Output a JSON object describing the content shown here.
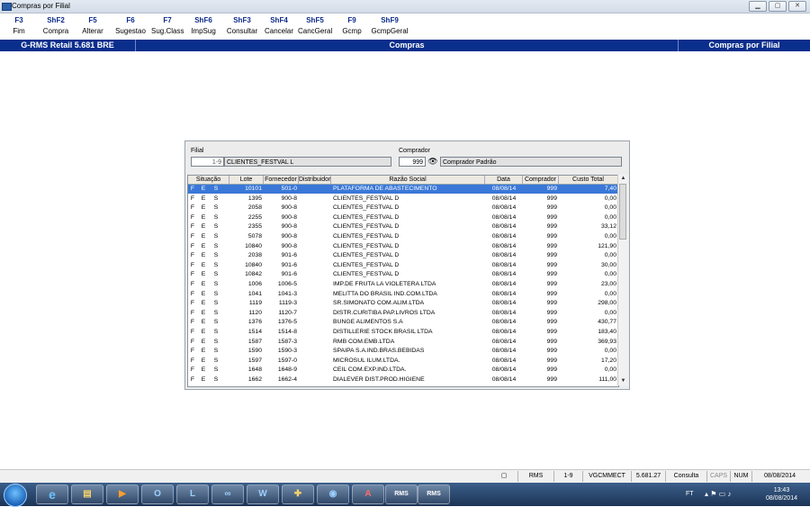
{
  "window": {
    "title": "Compras por Filial"
  },
  "fkeys": [
    {
      "key": "F3",
      "label": "Fim"
    },
    {
      "key": "ShF2",
      "label": "Compra"
    },
    {
      "key": "F5",
      "label": "Alterar"
    },
    {
      "key": "F6",
      "label": "Sugestao"
    },
    {
      "key": "F7",
      "label": "Sug.Class"
    },
    {
      "key": "ShF6",
      "label": "ImpSug"
    },
    {
      "key": "ShF3",
      "label": "Consultar"
    },
    {
      "key": "ShF4",
      "label": "Cancelar"
    },
    {
      "key": "ShF5",
      "label": "CancGeral"
    },
    {
      "key": "F9",
      "label": "Gcmp"
    },
    {
      "key": "ShF9",
      "label": "GcmpGeral"
    }
  ],
  "header": {
    "app": "G-RMS Retail 5.681 BRE",
    "module": "Compras",
    "screen": "Compras por Filial"
  },
  "filter": {
    "filial_label": "Filial",
    "filial_code": "1-9",
    "filial_name": "CLIENTES_FESTVAL L",
    "comprador_label": "Comprador",
    "comprador_code": "999",
    "comprador_name": "Comprador Padrão"
  },
  "grid": {
    "columns": [
      "Situação",
      "Lote",
      "Fornecedor",
      "Distribuidor",
      "Razão Social",
      "Data",
      "Comprador",
      "Custo Total"
    ],
    "rows": [
      {
        "s1": "F",
        "s2": "E",
        "s3": "S",
        "lote": "10101",
        "forn": "501-0",
        "razao": "PLATAFORMA DE ABASTECIMENTO",
        "data": "08/08/14",
        "comp": "999",
        "custo": "7,40",
        "selected": true
      },
      {
        "s1": "F",
        "s2": "E",
        "s3": "S",
        "lote": "1395",
        "forn": "900-8",
        "razao": "CLIENTES_FESTVAL D",
        "data": "08/08/14",
        "comp": "999",
        "custo": "0,00"
      },
      {
        "s1": "F",
        "s2": "E",
        "s3": "S",
        "lote": "2058",
        "forn": "900-8",
        "razao": "CLIENTES_FESTVAL D",
        "data": "08/08/14",
        "comp": "999",
        "custo": "0,00"
      },
      {
        "s1": "F",
        "s2": "E",
        "s3": "S",
        "lote": "2255",
        "forn": "900-8",
        "razao": "CLIENTES_FESTVAL D",
        "data": "08/08/14",
        "comp": "999",
        "custo": "0,00"
      },
      {
        "s1": "F",
        "s2": "E",
        "s3": "S",
        "lote": "2355",
        "forn": "900-8",
        "razao": "CLIENTES_FESTVAL D",
        "data": "08/08/14",
        "comp": "999",
        "custo": "33,12"
      },
      {
        "s1": "F",
        "s2": "E",
        "s3": "S",
        "lote": "5078",
        "forn": "900-8",
        "razao": "CLIENTES_FESTVAL D",
        "data": "08/08/14",
        "comp": "999",
        "custo": "0,00"
      },
      {
        "s1": "F",
        "s2": "E",
        "s3": "S",
        "lote": "10840",
        "forn": "900-8",
        "razao": "CLIENTES_FESTVAL D",
        "data": "08/08/14",
        "comp": "999",
        "custo": "121,90"
      },
      {
        "s1": "F",
        "s2": "E",
        "s3": "S",
        "lote": "2038",
        "forn": "901-6",
        "razao": "CLIENTES_FESTVAL D",
        "data": "08/08/14",
        "comp": "999",
        "custo": "0,00"
      },
      {
        "s1": "F",
        "s2": "E",
        "s3": "S",
        "lote": "10840",
        "forn": "901-6",
        "razao": "CLIENTES_FESTVAL D",
        "data": "08/08/14",
        "comp": "999",
        "custo": "30,00"
      },
      {
        "s1": "F",
        "s2": "E",
        "s3": "S",
        "lote": "10842",
        "forn": "901-6",
        "razao": "CLIENTES_FESTVAL D",
        "data": "08/08/14",
        "comp": "999",
        "custo": "0,00"
      },
      {
        "s1": "F",
        "s2": "E",
        "s3": "S",
        "lote": "1006",
        "forn": "1006-5",
        "razao": "IMP.DE FRUTA LA VIOLETERA LTDA",
        "data": "08/08/14",
        "comp": "999",
        "custo": "23,00"
      },
      {
        "s1": "F",
        "s2": "E",
        "s3": "S",
        "lote": "1041",
        "forn": "1041-3",
        "razao": "MELITTA DO BRASIL IND.COM.LTDA",
        "data": "08/08/14",
        "comp": "999",
        "custo": "0,00"
      },
      {
        "s1": "F",
        "s2": "E",
        "s3": "S",
        "lote": "1119",
        "forn": "1119-3",
        "razao": "SR.SIMONATO COM.ALIM.LTDA",
        "data": "08/08/14",
        "comp": "999",
        "custo": "298,00"
      },
      {
        "s1": "F",
        "s2": "E",
        "s3": "S",
        "lote": "1120",
        "forn": "1120-7",
        "razao": "DISTR.CURITIBA PAP.LIVROS LTDA",
        "data": "08/08/14",
        "comp": "999",
        "custo": "0,00"
      },
      {
        "s1": "F",
        "s2": "E",
        "s3": "S",
        "lote": "1376",
        "forn": "1376-5",
        "razao": "BUNGE ALIMENTOS S.A",
        "data": "08/08/14",
        "comp": "999",
        "custo": "430,77"
      },
      {
        "s1": "F",
        "s2": "E",
        "s3": "S",
        "lote": "1514",
        "forn": "1514-8",
        "razao": "DISTILLERIE STOCK  BRASIL LTDA",
        "data": "08/08/14",
        "comp": "999",
        "custo": "183,40"
      },
      {
        "s1": "F",
        "s2": "E",
        "s3": "S",
        "lote": "1587",
        "forn": "1587-3",
        "razao": "RMB COM.EMB.LTDA",
        "data": "08/08/14",
        "comp": "999",
        "custo": "369,93"
      },
      {
        "s1": "F",
        "s2": "E",
        "s3": "S",
        "lote": "1590",
        "forn": "1590-3",
        "razao": "SPAIPA S.A.IND.BRAS.BEBIDAS",
        "data": "08/08/14",
        "comp": "999",
        "custo": "0,00"
      },
      {
        "s1": "F",
        "s2": "E",
        "s3": "S",
        "lote": "1597",
        "forn": "1597-0",
        "razao": "MICROSUL ILUM.LTDA.",
        "data": "08/08/14",
        "comp": "999",
        "custo": "17,20"
      },
      {
        "s1": "F",
        "s2": "E",
        "s3": "S",
        "lote": "1648",
        "forn": "1648-9",
        "razao": "CEIL COM.EXP.IND.LTDA.",
        "data": "08/08/14",
        "comp": "999",
        "custo": "0,00"
      },
      {
        "s1": "F",
        "s2": "E",
        "s3": "S",
        "lote": "1662",
        "forn": "1662-4",
        "razao": "DIALEVER DIST.PROD.HIGIENE",
        "data": "08/08/14",
        "comp": "999",
        "custo": "111,00"
      }
    ]
  },
  "statusbar": {
    "app": "RMS",
    "filial": "1-9",
    "user": "VGCMMECT",
    "version": "5.681.27",
    "mode": "Consulta",
    "caps": "CAPS",
    "num": "NUM",
    "date": "08/08/2014"
  },
  "taskbar": {
    "apps": [
      "ie-icon",
      "explorer-icon",
      "media-icon",
      "outlook-icon",
      "lync-icon",
      "connector-icon",
      "word-icon",
      "install-icon",
      "network-icon",
      "pdf-icon",
      "rms-1",
      "rms-2"
    ],
    "rms_label": "RMS",
    "lang": "FT",
    "time": "13:43",
    "date": "08/08/2014"
  },
  "colors": {
    "header_bg": "#0a2e8c",
    "selection": "#3a78d8",
    "fkey_text": "#0b2a8a"
  }
}
